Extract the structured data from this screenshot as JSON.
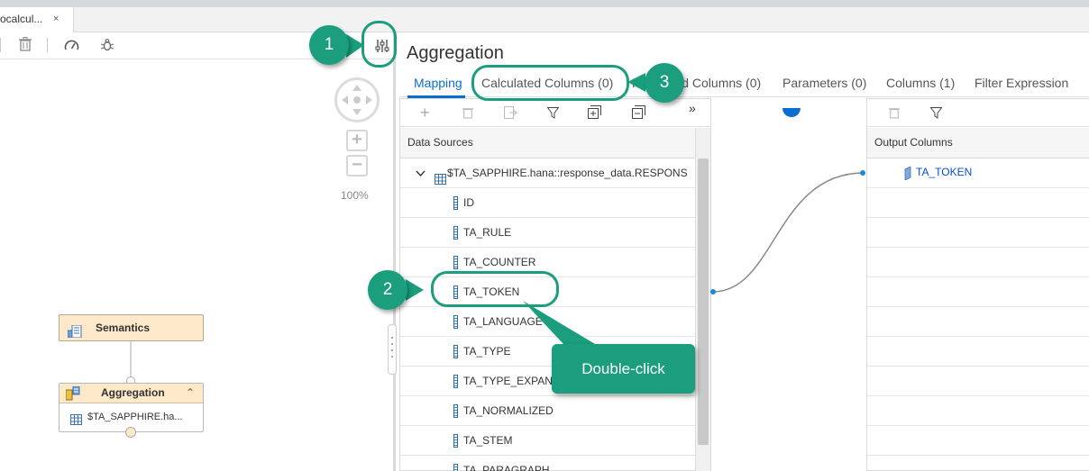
{
  "editor_tab": {
    "label": "ocalcul...",
    "close": "×"
  },
  "toolbar": {
    "delete_icon": "trash-icon",
    "performance_icon": "gauge-icon",
    "debug_icon": "bug-icon",
    "settings_icon": "sliders-icon"
  },
  "navigation": {
    "zoom_in": "+",
    "zoom_out": "−",
    "zoom_level": "100%"
  },
  "diagram": {
    "semantics_label": "Semantics",
    "aggregation_label": "Aggregation",
    "aggregation_source": "$TA_SAPPHIRE.ha...",
    "collapse": "⌃"
  },
  "details": {
    "title": "Aggregation",
    "tabs": [
      {
        "label": "Mapping",
        "active": true
      },
      {
        "label": "Calculated Columns (0)"
      },
      {
        "label": "Restricted Columns (0)"
      },
      {
        "label": "Parameters (0)"
      },
      {
        "label": "Columns (1)"
      },
      {
        "label": "Filter Expression"
      }
    ],
    "expand_toolbar": "»",
    "data_sources": {
      "header": "Data Sources",
      "source_node": "$TA_SAPPHIRE.hana::response_data.RESPONS",
      "columns": [
        "ID",
        "TA_RULE",
        "TA_COUNTER",
        "TA_TOKEN",
        "TA_LANGUAGE",
        "TA_TYPE",
        "TA_TYPE_EXPAN",
        "TA_NORMALIZED",
        "TA_STEM",
        "TA_PARAGRAPH"
      ]
    },
    "output": {
      "header": "Output Columns",
      "columns": [
        "TA_TOKEN"
      ]
    }
  },
  "callouts": {
    "step1": "1",
    "step2": "2",
    "step3": "3",
    "double_click": "Double-click"
  },
  "colors": {
    "accent": "#0a6ed1",
    "callout": "#1a9e7d",
    "node_fill": "#fde9c9"
  }
}
